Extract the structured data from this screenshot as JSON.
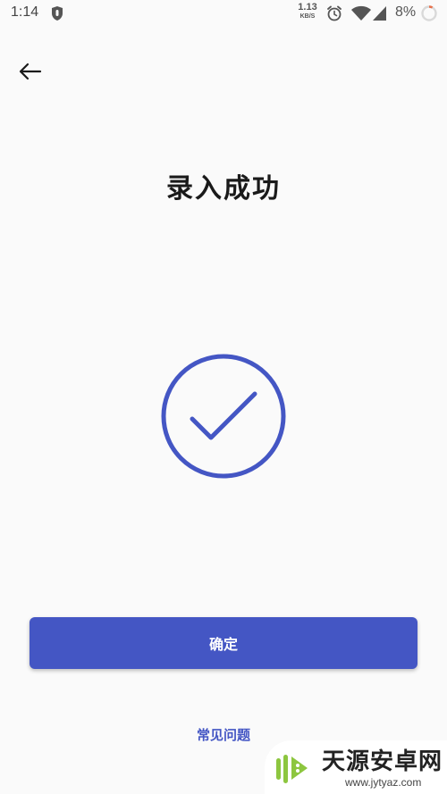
{
  "status_bar": {
    "time": "1:14",
    "net_speed_value": "1.13",
    "net_speed_unit": "KB/S",
    "battery_percent": "8%"
  },
  "header": {
    "back_icon": "arrow-left-icon"
  },
  "main": {
    "title": "录入成功",
    "success_icon": "check-circle-icon",
    "confirm_label": "确定",
    "faq_label": "常见问题"
  },
  "watermark": {
    "name": "天源安卓网",
    "url": "www.jytyaz.com"
  },
  "colors": {
    "accent": "#4456c4",
    "background": "#fafafa",
    "title_text": "#1a1a1a",
    "button_text": "#ffffff"
  }
}
